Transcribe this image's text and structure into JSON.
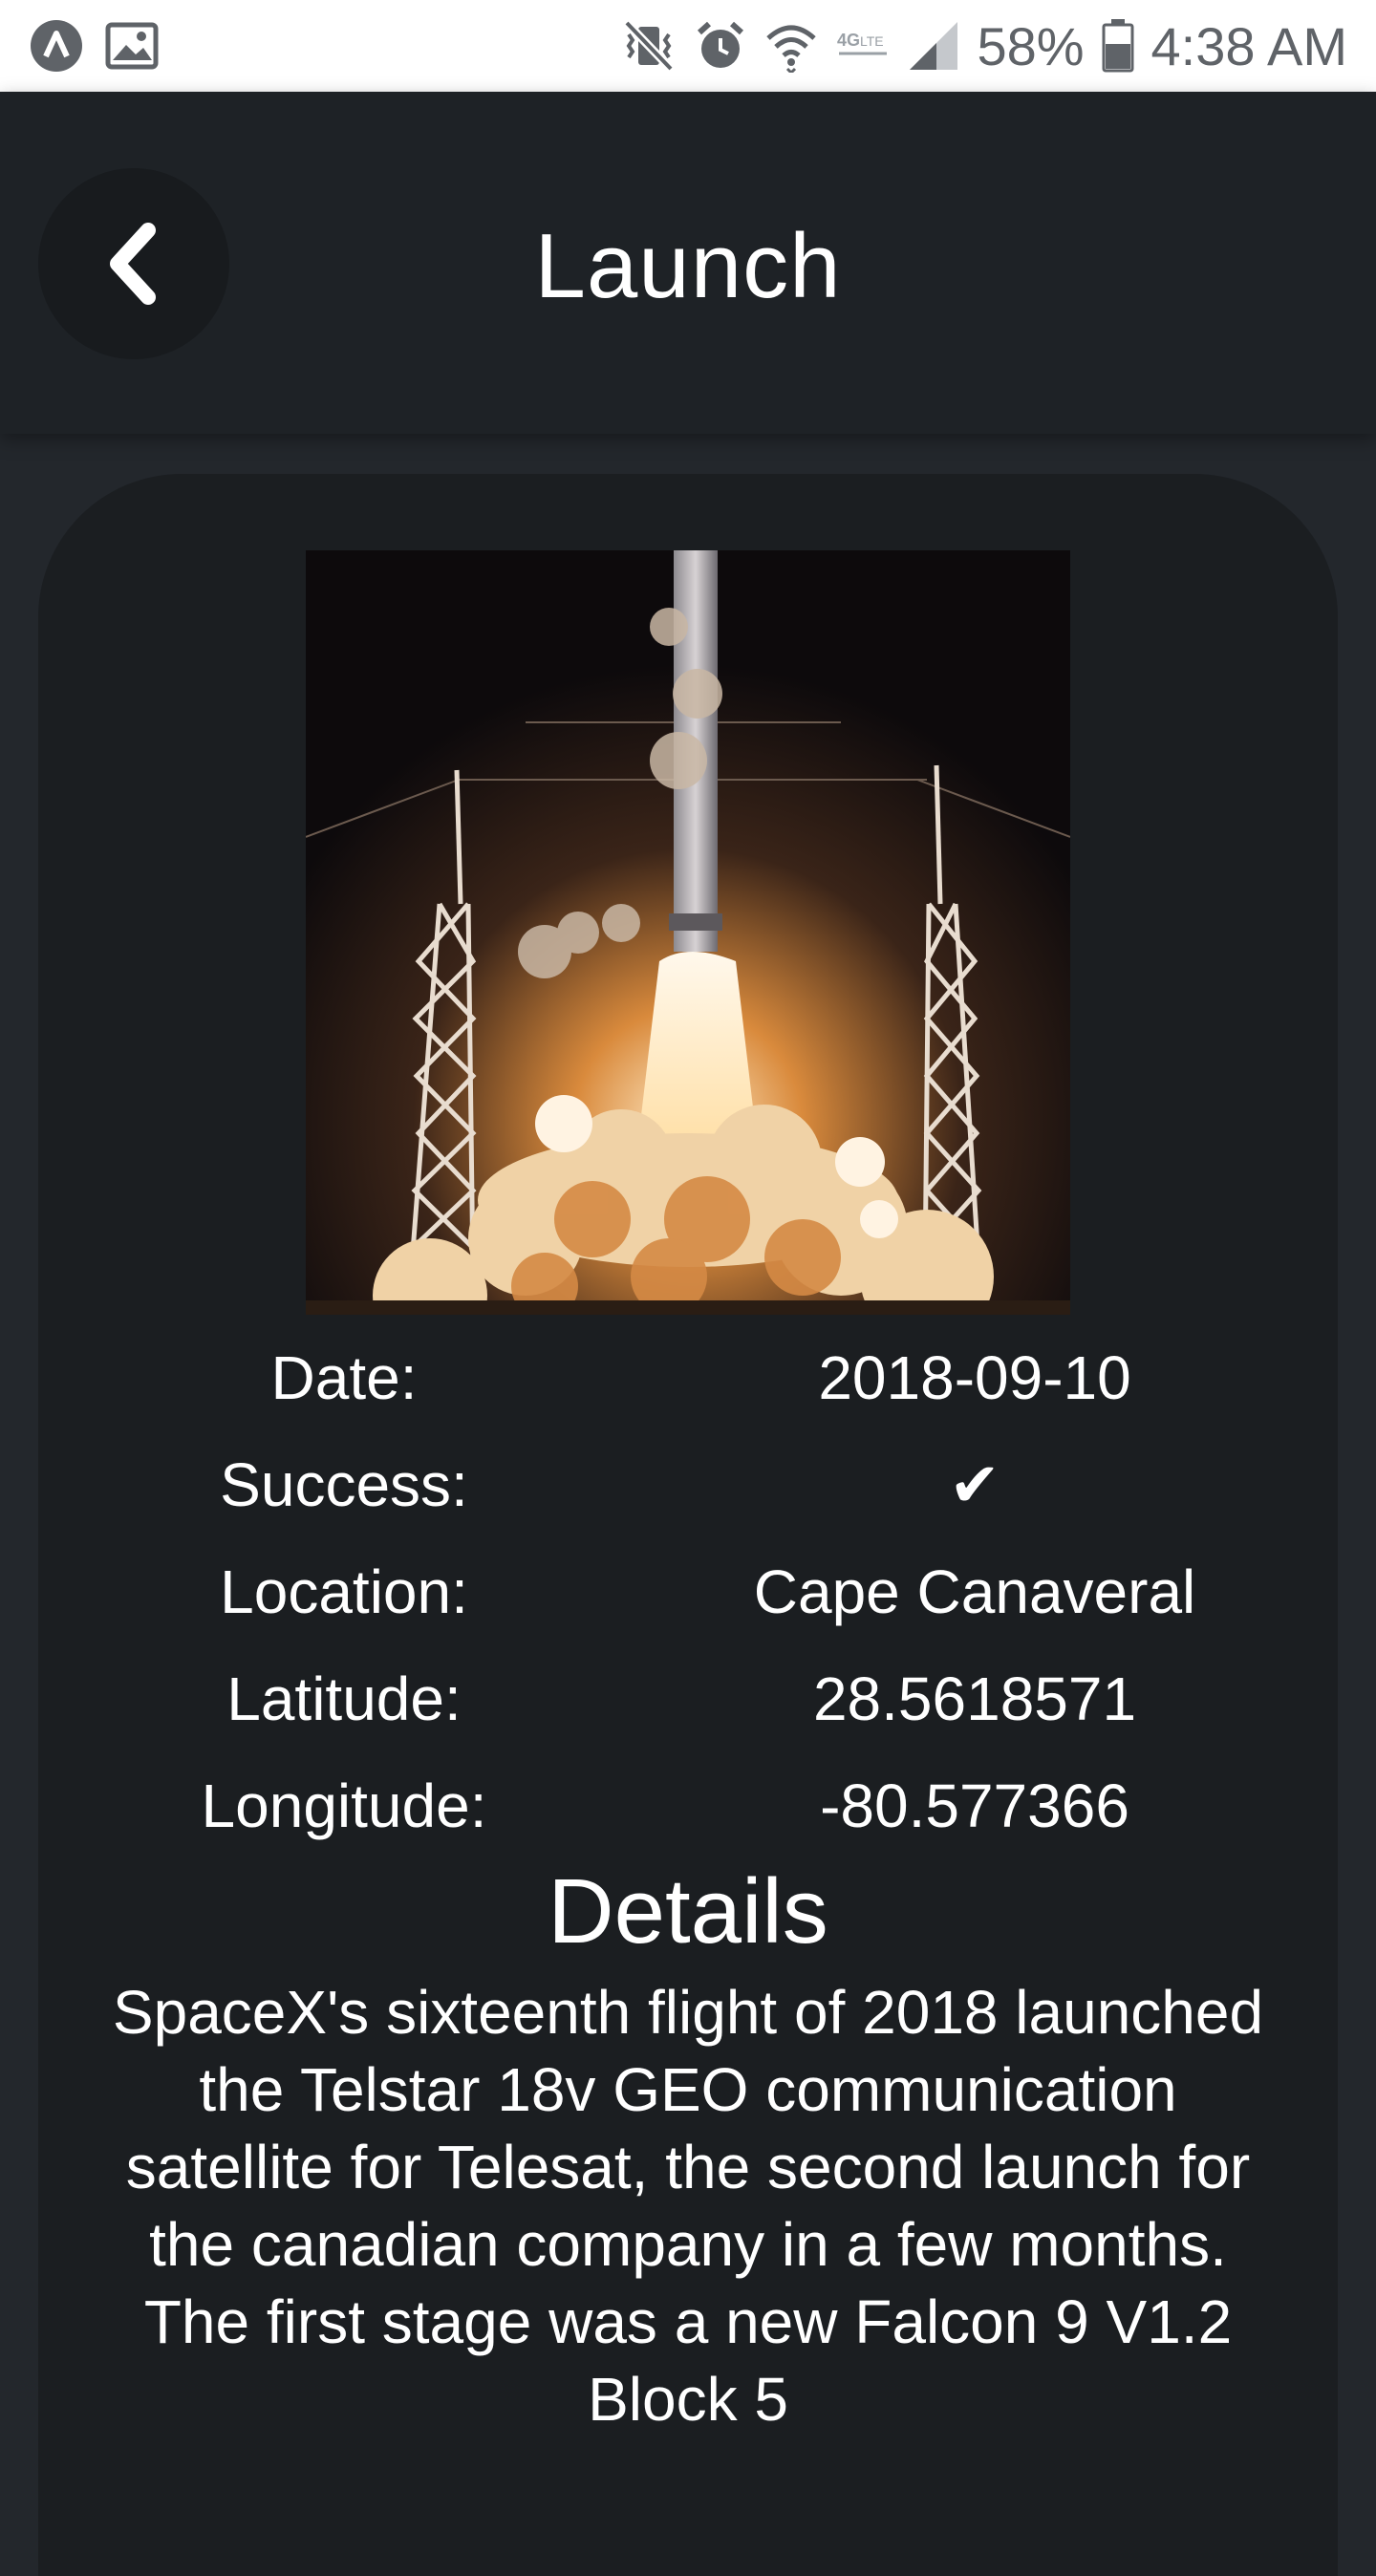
{
  "status_bar": {
    "battery_percent": "58%",
    "time": "4:38 AM",
    "icons": [
      "app-launcher-icon",
      "image-notification-icon",
      "vibrate-mute-icon",
      "alarm-icon",
      "wifi-icon",
      "lte-icon",
      "signal-icon",
      "battery-icon"
    ]
  },
  "header": {
    "title": "Launch",
    "back_icon": "chevron-left-icon"
  },
  "launch": {
    "image_alt": "Falcon 9 night launch",
    "fields": [
      {
        "label": "Date:",
        "value": "2018-09-10"
      },
      {
        "label": "Success:",
        "value": "✔"
      },
      {
        "label": "Location:",
        "value": "Cape Canaveral"
      },
      {
        "label": "Latitude:",
        "value": "28.5618571"
      },
      {
        "label": "Longitude:",
        "value": "-80.577366"
      }
    ],
    "details_heading": "Details",
    "details_text": "SpaceX's sixteenth flight of 2018 launched the Telstar 18v GEO communication satellite for Telesat, the second launch for the canadian company in a few months. The first stage was a new Falcon 9 V1.2 Block 5"
  },
  "colors": {
    "background": "#23272c",
    "header": "#1e2226",
    "card": "#1b1e21",
    "text": "#ffffff"
  }
}
